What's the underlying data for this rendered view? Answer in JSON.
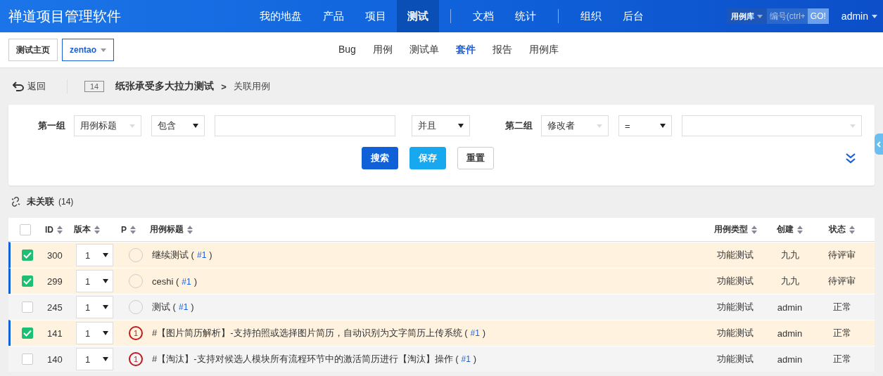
{
  "app_title": "禅道项目管理软件",
  "nav_groups": [
    [
      {
        "label": "我的地盘",
        "selected": false
      },
      {
        "label": "产品",
        "selected": false
      },
      {
        "label": "项目",
        "selected": false
      },
      {
        "label": "测试",
        "selected": true
      }
    ],
    [
      {
        "label": "文档",
        "selected": false
      },
      {
        "label": "统计",
        "selected": false
      }
    ],
    [
      {
        "label": "组织",
        "selected": false
      },
      {
        "label": "后台",
        "selected": false
      }
    ]
  ],
  "quick_search": {
    "scope": "用例库",
    "placeholder": "编号(ctrl+",
    "button": "GO!"
  },
  "user": "admin",
  "breadcrumbs": [
    {
      "label": "测试主页",
      "dropdown": false
    },
    {
      "label": "zentao",
      "dropdown": true
    }
  ],
  "subnav": [
    {
      "label": "Bug",
      "selected": false
    },
    {
      "label": "用例",
      "selected": false
    },
    {
      "label": "测试单",
      "selected": false
    },
    {
      "label": "套件",
      "selected": true
    },
    {
      "label": "报告",
      "selected": false
    },
    {
      "label": "用例库",
      "selected": false
    }
  ],
  "page_header": {
    "back": "返回",
    "id": "14",
    "title": "纸张承受多大拉力测试",
    "separator": ">",
    "subtitle": "关联用例"
  },
  "search_form": {
    "groups": [
      {
        "label": "第一组",
        "field": "用例标题",
        "operator": "包含",
        "kind": "input"
      },
      {
        "label": "第二组",
        "field": "修改者",
        "operator": "=",
        "kind": "select"
      }
    ],
    "and_or": "并且",
    "buttons": [
      {
        "label": "搜索",
        "kind": "primary"
      },
      {
        "label": "保存",
        "kind": "info"
      },
      {
        "label": "重置",
        "kind": "default"
      }
    ]
  },
  "section": {
    "title": "未关联",
    "count": "(14)"
  },
  "table": {
    "select_all": {
      "checked": false
    },
    "columns": [
      "ID",
      "版本",
      "P",
      "用例标题",
      "用例类型",
      "创建",
      "状态"
    ],
    "rows": [
      {
        "checked": true,
        "id": "300",
        "version": "1",
        "title": [
          {
            "kind": "text",
            "text": "继续测试 ("
          },
          {
            "kind": "link",
            "text": "#1"
          },
          {
            "kind": "text",
            "text": ")"
          }
        ],
        "type": "功能测试",
        "creator": "九九",
        "status": "待评审"
      },
      {
        "checked": true,
        "id": "299",
        "version": "1",
        "title": [
          {
            "kind": "text",
            "text": "ceshi ("
          },
          {
            "kind": "link",
            "text": "#1"
          },
          {
            "kind": "text",
            "text": ")"
          }
        ],
        "type": "功能测试",
        "creator": "九九",
        "status": "待评审"
      },
      {
        "checked": false,
        "id": "245",
        "version": "1",
        "title": [
          {
            "kind": "text",
            "text": "测试 ("
          },
          {
            "kind": "link",
            "text": "#1"
          },
          {
            "kind": "text",
            "text": ")"
          }
        ],
        "type": "功能测试",
        "creator": "admin",
        "status": "正常"
      },
      {
        "checked": true,
        "id": "141",
        "version": "1",
        "priority": "1",
        "title": [
          {
            "kind": "text",
            "text": "#【图片简历解析】-支持拍照或选择图片简历，自动识别为文字简历上传系统 ("
          },
          {
            "kind": "link",
            "text": "#1"
          },
          {
            "kind": "text",
            "text": ")"
          }
        ],
        "type": "功能测试",
        "creator": "admin",
        "status": "正常"
      },
      {
        "checked": false,
        "id": "140",
        "version": "1",
        "priority": "1",
        "title": [
          {
            "kind": "text",
            "text": "#【淘汰】-支持对候选人模块所有流程环节中的激活简历进行【淘汰】操作 ("
          },
          {
            "kind": "link",
            "text": "#1"
          },
          {
            "kind": "text",
            "text": ")"
          }
        ],
        "type": "功能测试",
        "creator": "admin",
        "status": "正常"
      }
    ]
  }
}
